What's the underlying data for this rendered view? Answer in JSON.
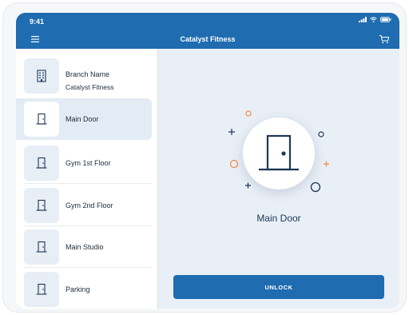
{
  "status_bar": {
    "time": "9:41"
  },
  "app_bar": {
    "title": "Catalyst Fitness"
  },
  "sidebar": {
    "branch": {
      "label": "Branch Name",
      "value": "Catalyst Fitness"
    },
    "items": [
      {
        "label": "Main Door",
        "selected": true
      },
      {
        "label": "Gym 1st Floor",
        "selected": false
      },
      {
        "label": "Gym 2nd Floor",
        "selected": false
      },
      {
        "label": "Main Studio",
        "selected": false
      },
      {
        "label": "Parking",
        "selected": false
      }
    ]
  },
  "detail": {
    "door_name": "Main Door",
    "unlock_label": "UNLOCK"
  },
  "colors": {
    "primary": "#1f6cb0",
    "accent_orange": "#f08a3c",
    "navy": "#1d3756"
  }
}
